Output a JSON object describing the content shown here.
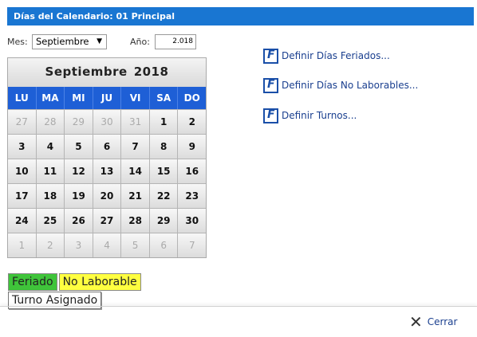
{
  "title": "Días del Calendario: 01 Principal",
  "controls": {
    "mes_label": "Mes:",
    "mes_value": "Septiembre",
    "ano_label": "Año:",
    "ano_value": "2.018"
  },
  "calendar": {
    "month": "Septiembre",
    "year": "2018",
    "weekdays": [
      "LU",
      "MA",
      "MI",
      "JU",
      "VI",
      "SA",
      "DO"
    ],
    "weeks": [
      [
        {
          "d": "27",
          "o": true
        },
        {
          "d": "28",
          "o": true
        },
        {
          "d": "29",
          "o": true
        },
        {
          "d": "30",
          "o": true
        },
        {
          "d": "31",
          "o": true
        },
        {
          "d": "1",
          "o": false
        },
        {
          "d": "2",
          "o": false
        }
      ],
      [
        {
          "d": "3",
          "o": false
        },
        {
          "d": "4",
          "o": false
        },
        {
          "d": "5",
          "o": false
        },
        {
          "d": "6",
          "o": false
        },
        {
          "d": "7",
          "o": false
        },
        {
          "d": "8",
          "o": false
        },
        {
          "d": "9",
          "o": false
        }
      ],
      [
        {
          "d": "10",
          "o": false
        },
        {
          "d": "11",
          "o": false
        },
        {
          "d": "12",
          "o": false
        },
        {
          "d": "13",
          "o": false
        },
        {
          "d": "14",
          "o": false
        },
        {
          "d": "15",
          "o": false
        },
        {
          "d": "16",
          "o": false
        }
      ],
      [
        {
          "d": "17",
          "o": false
        },
        {
          "d": "18",
          "o": false
        },
        {
          "d": "19",
          "o": false
        },
        {
          "d": "20",
          "o": false
        },
        {
          "d": "21",
          "o": false
        },
        {
          "d": "22",
          "o": false
        },
        {
          "d": "23",
          "o": false
        }
      ],
      [
        {
          "d": "24",
          "o": false
        },
        {
          "d": "25",
          "o": false
        },
        {
          "d": "26",
          "o": false
        },
        {
          "d": "27",
          "o": false
        },
        {
          "d": "28",
          "o": false
        },
        {
          "d": "29",
          "o": false
        },
        {
          "d": "30",
          "o": false
        }
      ],
      [
        {
          "d": "1",
          "o": true
        },
        {
          "d": "2",
          "o": true
        },
        {
          "d": "3",
          "o": true
        },
        {
          "d": "4",
          "o": true
        },
        {
          "d": "5",
          "o": true
        },
        {
          "d": "6",
          "o": true
        },
        {
          "d": "7",
          "o": true
        }
      ]
    ]
  },
  "links": [
    {
      "label": "Definir Días Feriados...",
      "icon": "f-document-icon"
    },
    {
      "label": "Definir Días No Laborables...",
      "icon": "f-document-icon"
    },
    {
      "label": "Definir Turnos...",
      "icon": "f-document-icon"
    }
  ],
  "legend": {
    "feriado": "Feriado",
    "no_laborable": "No Laborable",
    "turno": "Turno Asignado",
    "colors": {
      "feriado": "#3fc43a",
      "no_laborable": "#ffff40"
    }
  },
  "footer": {
    "cerrar_label": "Cerrar",
    "cerrar_icon": "close-icon"
  },
  "colors": {
    "accent": "#1976d2",
    "weekday_header": "#1e5fd6",
    "link": "#1a3f8f"
  }
}
